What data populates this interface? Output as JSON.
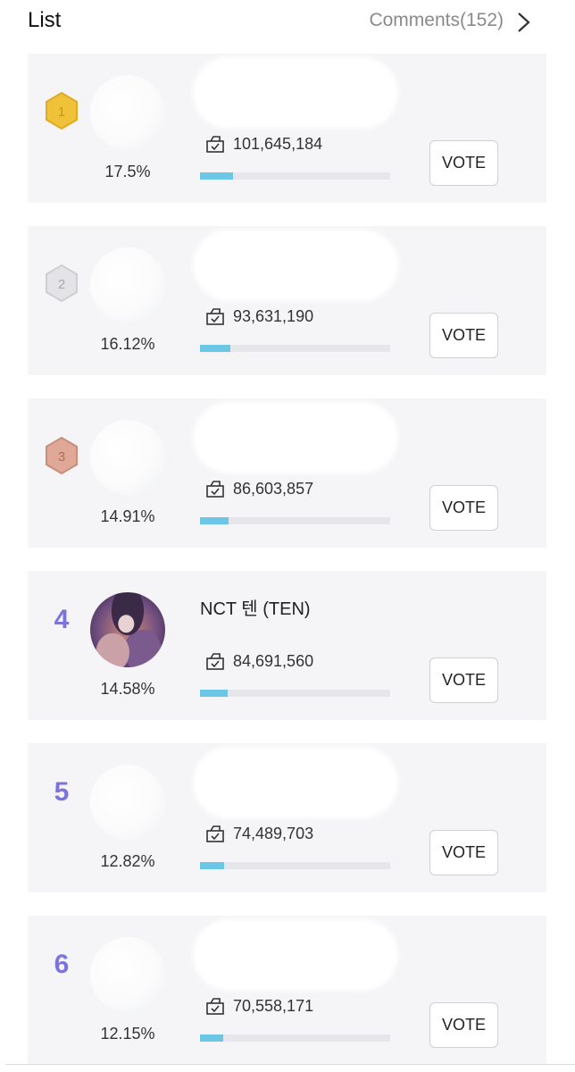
{
  "header": {
    "title": "List",
    "comments_label": "Comments(152)"
  },
  "icons": {
    "next": "chevron-right-icon",
    "ballot": "ballot-box-icon",
    "medal": "hexagon-medal-icon"
  },
  "colors": {
    "accent_rank": "#7b74dc",
    "bar_fill": "#6cc6e6",
    "gold": "#f0c23a",
    "silver": "#d9d9dc",
    "bronze": "#d79a85"
  },
  "entries": [
    {
      "rank": "1",
      "name": "",
      "votes": "101,645,184",
      "percent": "17.5%",
      "share": 0.175,
      "button": "VOTE"
    },
    {
      "rank": "2",
      "name": "",
      "votes": "93,631,190",
      "percent": "16.12%",
      "share": 0.1612,
      "button": "VOTE"
    },
    {
      "rank": "3",
      "name": "",
      "votes": "86,603,857",
      "percent": "14.91%",
      "share": 0.1491,
      "button": "VOTE"
    },
    {
      "rank": "4",
      "name": "NCT 텐 (TEN)",
      "votes": "84,691,560",
      "percent": "14.58%",
      "share": 0.1458,
      "button": "VOTE"
    },
    {
      "rank": "5",
      "name": "",
      "votes": "74,489,703",
      "percent": "12.82%",
      "share": 0.1282,
      "button": "VOTE"
    },
    {
      "rank": "6",
      "name": "",
      "votes": "70,558,171",
      "percent": "12.15%",
      "share": 0.1215,
      "button": "VOTE"
    }
  ]
}
